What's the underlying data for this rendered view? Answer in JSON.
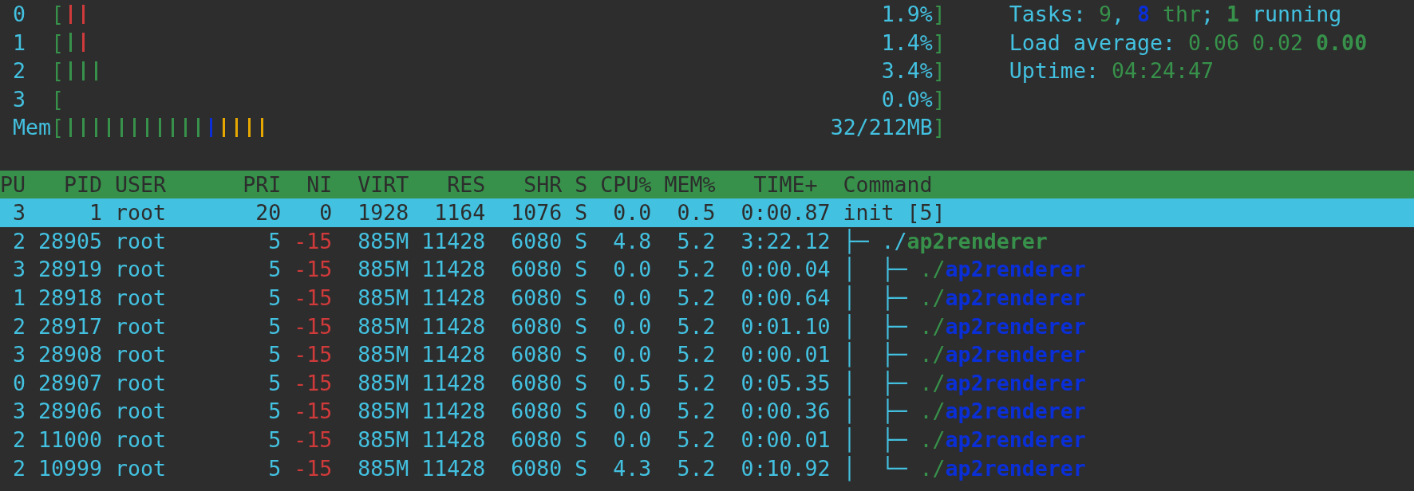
{
  "meters": [
    {
      "label": "0",
      "open": "[",
      "close": "]",
      "reading": "1.9%",
      "segments": [
        {
          "color": "#d03a3a"
        },
        {
          "color": "#d03a3a"
        }
      ]
    },
    {
      "label": "1",
      "open": "[",
      "close": "]",
      "reading": "1.4%",
      "segments": [
        {
          "color": "#37914a"
        },
        {
          "color": "#d03a3a"
        }
      ]
    },
    {
      "label": "2",
      "open": "[",
      "close": "]",
      "reading": "3.4%",
      "segments": [
        {
          "color": "#37914a"
        },
        {
          "color": "#37914a"
        },
        {
          "color": "#37914a"
        }
      ]
    },
    {
      "label": "3",
      "open": "[",
      "close": "]",
      "reading": "0.0%"
    },
    {
      "label": "Mem",
      "open": "[",
      "close": "]",
      "reading": "32/212MB",
      "segments": [
        {
          "color": "#37914a"
        },
        {
          "color": "#37914a"
        },
        {
          "color": "#37914a"
        },
        {
          "color": "#37914a"
        },
        {
          "color": "#37914a"
        },
        {
          "color": "#37914a"
        },
        {
          "color": "#37914a"
        },
        {
          "color": "#37914a"
        },
        {
          "color": "#37914a"
        },
        {
          "color": "#37914a"
        },
        {
          "color": "#37914a"
        },
        {
          "color": "#0a2fd8"
        },
        {
          "color": "#e6a800"
        },
        {
          "color": "#e6a800"
        },
        {
          "color": "#e6a800"
        },
        {
          "color": "#e6a800"
        }
      ]
    }
  ],
  "summary": [
    {
      "parts": [
        {
          "kind": "label",
          "text": "Tasks: "
        },
        {
          "kind": "value",
          "text": "9"
        },
        {
          "kind": "label",
          "text": ", "
        },
        {
          "kind": "threads",
          "text": "8"
        },
        {
          "kind": "value",
          "text": " thr"
        },
        {
          "kind": "label",
          "text": "; "
        },
        {
          "kind": "strong",
          "text": "1"
        },
        {
          "kind": "label",
          "text": " running"
        }
      ]
    },
    {
      "parts": [
        {
          "kind": "label",
          "text": "Load average: "
        },
        {
          "kind": "value",
          "text": "0.06 0.02 "
        },
        {
          "kind": "strong",
          "text": "0.00"
        }
      ]
    },
    {
      "parts": [
        {
          "kind": "label",
          "text": "Uptime: "
        },
        {
          "kind": "value",
          "text": "04:24:47"
        }
      ]
    }
  ],
  "table": {
    "columns": [
      "PU",
      "PID",
      "USER",
      "PRI",
      "NI",
      "VIRT",
      "RES",
      "SHR",
      "S",
      "CPU%",
      "MEM%",
      "TIME+",
      "Command"
    ],
    "rows": [
      {
        "selected": true,
        "cells": [
          "3",
          "1",
          "root",
          "20",
          "0",
          "1928",
          "1164",
          "1076",
          "S",
          "0.0",
          "0.5",
          "0:00.87"
        ],
        "ni_raised": false,
        "kind": "plain",
        "tree": "",
        "path": "",
        "command": "init [5]"
      },
      {
        "selected": false,
        "cells": [
          "2",
          "28905",
          "root",
          "5",
          "-15",
          "885M",
          "11428",
          "6080",
          "S",
          "4.8",
          "5.2",
          "3:22.12"
        ],
        "ni_raised": true,
        "kind": "process",
        "tree": "├─ ",
        "path": "./",
        "command": "ap2renderer"
      },
      {
        "selected": false,
        "cells": [
          "3",
          "28919",
          "root",
          "5",
          "-15",
          "885M",
          "11428",
          "6080",
          "S",
          "0.0",
          "5.2",
          "0:00.04"
        ],
        "ni_raised": true,
        "kind": "thread",
        "tree": "│  ├─ ",
        "path": "./",
        "command": "ap2renderer"
      },
      {
        "selected": false,
        "cells": [
          "1",
          "28918",
          "root",
          "5",
          "-15",
          "885M",
          "11428",
          "6080",
          "S",
          "0.0",
          "5.2",
          "0:00.64"
        ],
        "ni_raised": true,
        "kind": "thread",
        "tree": "│  ├─ ",
        "path": "./",
        "command": "ap2renderer"
      },
      {
        "selected": false,
        "cells": [
          "2",
          "28917",
          "root",
          "5",
          "-15",
          "885M",
          "11428",
          "6080",
          "S",
          "0.0",
          "5.2",
          "0:01.10"
        ],
        "ni_raised": true,
        "kind": "thread",
        "tree": "│  ├─ ",
        "path": "./",
        "command": "ap2renderer"
      },
      {
        "selected": false,
        "cells": [
          "3",
          "28908",
          "root",
          "5",
          "-15",
          "885M",
          "11428",
          "6080",
          "S",
          "0.0",
          "5.2",
          "0:00.01"
        ],
        "ni_raised": true,
        "kind": "thread",
        "tree": "│  ├─ ",
        "path": "./",
        "command": "ap2renderer"
      },
      {
        "selected": false,
        "cells": [
          "0",
          "28907",
          "root",
          "5",
          "-15",
          "885M",
          "11428",
          "6080",
          "S",
          "0.5",
          "5.2",
          "0:05.35"
        ],
        "ni_raised": true,
        "kind": "thread",
        "tree": "│  ├─ ",
        "path": "./",
        "command": "ap2renderer"
      },
      {
        "selected": false,
        "cells": [
          "3",
          "28906",
          "root",
          "5",
          "-15",
          "885M",
          "11428",
          "6080",
          "S",
          "0.0",
          "5.2",
          "0:00.36"
        ],
        "ni_raised": true,
        "kind": "thread",
        "tree": "│  ├─ ",
        "path": "./",
        "command": "ap2renderer"
      },
      {
        "selected": false,
        "cells": [
          "2",
          "11000",
          "root",
          "5",
          "-15",
          "885M",
          "11428",
          "6080",
          "S",
          "0.0",
          "5.2",
          "0:00.01"
        ],
        "ni_raised": true,
        "kind": "thread",
        "tree": "│  ├─ ",
        "path": "./",
        "command": "ap2renderer"
      },
      {
        "selected": false,
        "cells": [
          "2",
          "10999",
          "root",
          "5",
          "-15",
          "885M",
          "11428",
          "6080",
          "S",
          "4.3",
          "5.2",
          "0:10.92"
        ],
        "ni_raised": true,
        "kind": "thread",
        "tree": "│  └─ ",
        "path": "./",
        "command": "ap2renderer"
      }
    ]
  }
}
